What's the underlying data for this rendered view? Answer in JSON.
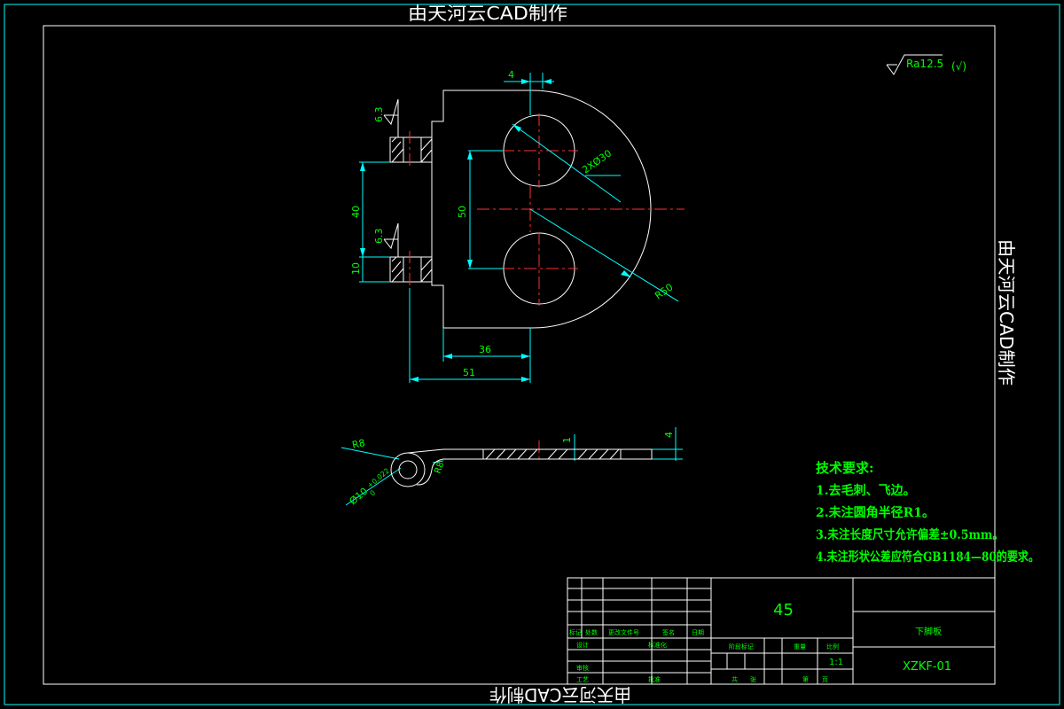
{
  "watermarks": {
    "top": "由天河云CAD制作",
    "right": "由天河云CAD制作",
    "bottom": "由天河云CAD制作"
  },
  "roughness": {
    "general": "Ra12.5",
    "general_suffix": "(√)",
    "face_top": "6.3",
    "face_bottom": "6.3"
  },
  "dimensions": {
    "thickness_top": "4",
    "holes": "2XØ30",
    "hole_spacing": "50",
    "height_40": "40",
    "height_10": "10",
    "radius_50": "R50",
    "width_36": "36",
    "width_51": "51",
    "radius_8": "R8",
    "bore": "Ø10",
    "bore_tol_upper": "+0.022",
    "bore_tol_lower": "0",
    "radius_b8": "R8",
    "gap_1": "1",
    "thickness_4": "4"
  },
  "requirements": {
    "title": "技术要求:",
    "items": [
      "1.去毛刺、飞边。",
      "2.未注圆角半径R1。",
      "3.未注长度尺寸允许偏差±0.5mm。",
      "4.未注形状公差应符合GB1184—80的要求。"
    ]
  },
  "title_block": {
    "material": "45",
    "part_name": "下脚板",
    "drawing_no": "XZKF-01",
    "scale": "1:1",
    "labels": {
      "mark": "标记",
      "count": "处数",
      "change_doc": "更改文件号",
      "signature": "签名",
      "date": "日期",
      "design": "设计",
      "standardization": "标准化",
      "review": "审核",
      "process": "工艺",
      "approve": "批准",
      "stage_mark": "阶段标记",
      "weight": "重量",
      "ratio": "比例",
      "sheets_total": "共",
      "sheet": "张",
      "sheet_no": "第",
      "page": "页"
    }
  }
}
